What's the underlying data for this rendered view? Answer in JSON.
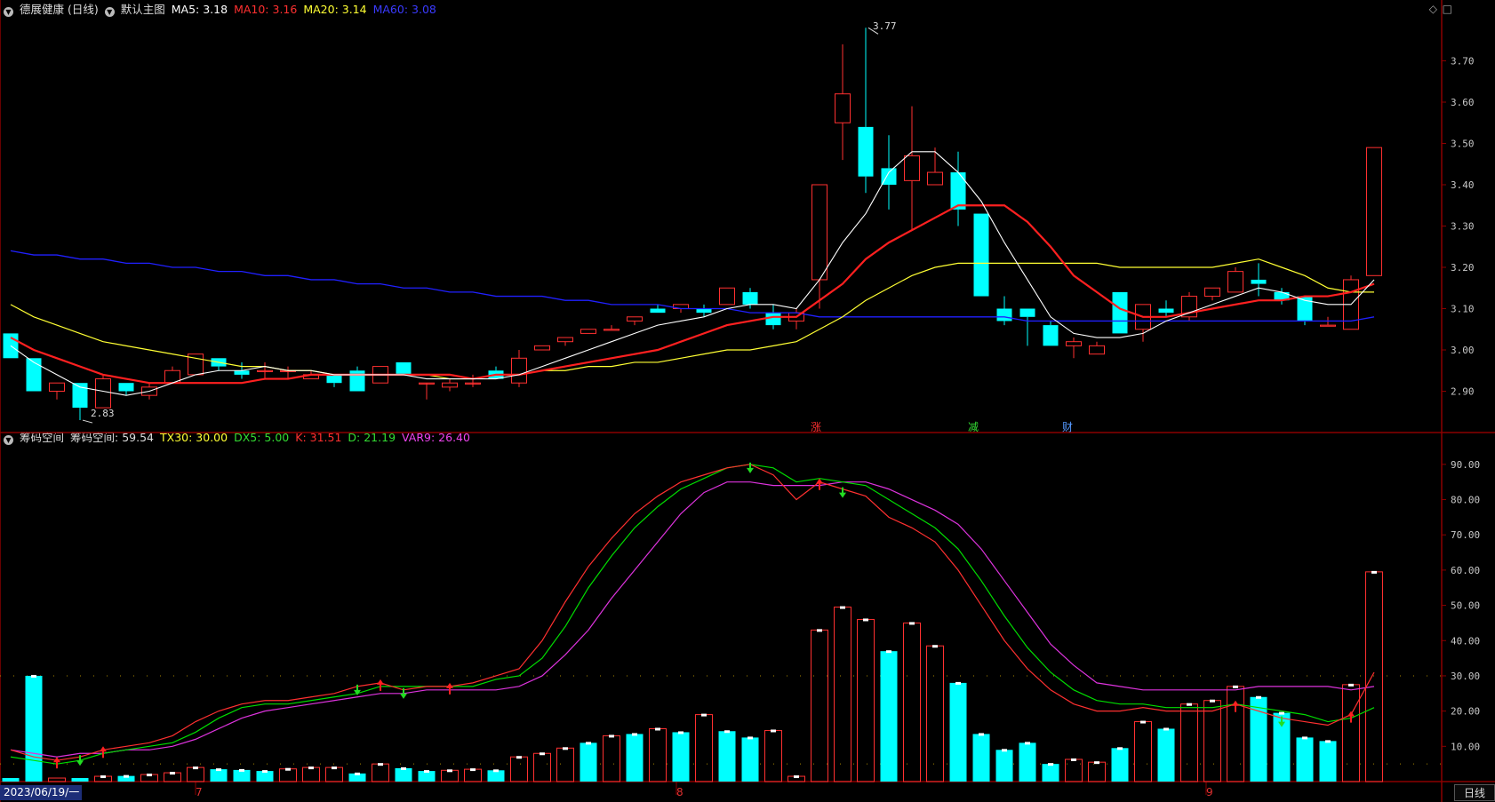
{
  "main_header": {
    "stock": "德展健康 (日线)",
    "mode": "默认主图",
    "ma5": "MA5: 3.18",
    "ma10": "MA10: 3.16",
    "ma20": "MA20: 3.14",
    "ma60": "MA60: 3.08"
  },
  "sub_header": {
    "name": "筹码空间",
    "value": "筹码空间: 59.54",
    "tx30": "TX30: 30.00",
    "dx5": "DX5: 5.00",
    "k": "K: 31.51",
    "d": "D: 21.19",
    "var9": "VAR9: 26.40"
  },
  "controls": {
    "diamond_icon": "◇",
    "square_icon": "□"
  },
  "colors": {
    "up": "#ff3030",
    "down": "#00ffff",
    "ma5": "#ffffff",
    "ma10": "#ff2020",
    "ma20": "#ffff33",
    "ma60": "#2020ff",
    "axis": "#8b0000",
    "k": "#ff3030",
    "d": "#00dd00",
    "var9": "#dd33dd"
  },
  "annotations": {
    "high": "3.77",
    "low": "2.83"
  },
  "events": [
    "涨",
    "减",
    "财"
  ],
  "footer": {
    "date": "2023/06/19/一",
    "period": "日线",
    "months": [
      "7",
      "8",
      "9"
    ]
  },
  "chart_data": [
    {
      "type": "candlestick",
      "y_axis_ticks": [
        "3.70",
        "3.60",
        "3.50",
        "3.40",
        "3.30",
        "3.20",
        "3.10",
        "3.00",
        "2.90"
      ],
      "ylim": [
        2.8,
        3.8
      ],
      "candles": [
        [
          3.04,
          2.98,
          3.04,
          2.98
        ],
        [
          2.98,
          2.9,
          2.98,
          2.9
        ],
        [
          2.9,
          2.92,
          2.92,
          2.88
        ],
        [
          2.92,
          2.86,
          2.92,
          2.83
        ],
        [
          2.86,
          2.93,
          2.94,
          2.86
        ],
        [
          2.92,
          2.9,
          2.92,
          2.89
        ],
        [
          2.89,
          2.91,
          2.92,
          2.88
        ],
        [
          2.92,
          2.95,
          2.96,
          2.92
        ],
        [
          2.94,
          2.99,
          2.99,
          2.94
        ],
        [
          2.98,
          2.96,
          2.98,
          2.95
        ],
        [
          2.95,
          2.94,
          2.97,
          2.93
        ],
        [
          2.95,
          2.95,
          2.97,
          2.93
        ],
        [
          2.95,
          2.95,
          2.96,
          2.93
        ],
        [
          2.93,
          2.94,
          2.95,
          2.93
        ],
        [
          2.94,
          2.92,
          2.94,
          2.91
        ],
        [
          2.95,
          2.9,
          2.96,
          2.9
        ],
        [
          2.92,
          2.96,
          2.96,
          2.92
        ],
        [
          2.97,
          2.94,
          2.97,
          2.94
        ],
        [
          2.92,
          2.92,
          2.92,
          2.88
        ],
        [
          2.91,
          2.92,
          2.93,
          2.9
        ],
        [
          2.92,
          2.92,
          2.94,
          2.91
        ],
        [
          2.95,
          2.93,
          2.96,
          2.93
        ],
        [
          2.92,
          2.98,
          3.0,
          2.91
        ],
        [
          3.0,
          3.01,
          3.01,
          3.0
        ],
        [
          3.02,
          3.03,
          3.03,
          3.01
        ],
        [
          3.04,
          3.05,
          3.05,
          3.04
        ],
        [
          3.05,
          3.05,
          3.06,
          3.05
        ],
        [
          3.07,
          3.08,
          3.08,
          3.06
        ],
        [
          3.1,
          3.09,
          3.11,
          3.09
        ],
        [
          3.1,
          3.11,
          3.11,
          3.09
        ],
        [
          3.1,
          3.09,
          3.11,
          3.08
        ],
        [
          3.11,
          3.15,
          3.15,
          3.11
        ],
        [
          3.14,
          3.11,
          3.15,
          3.1
        ],
        [
          3.09,
          3.06,
          3.11,
          3.05
        ],
        [
          3.07,
          3.09,
          3.1,
          3.05
        ],
        [
          3.17,
          3.4,
          3.4,
          3.1
        ],
        [
          3.55,
          3.62,
          3.74,
          3.46
        ],
        [
          3.54,
          3.42,
          3.78,
          3.38
        ],
        [
          3.44,
          3.4,
          3.52,
          3.34
        ],
        [
          3.41,
          3.47,
          3.59,
          3.29
        ],
        [
          3.4,
          3.43,
          3.49,
          3.4
        ],
        [
          3.43,
          3.34,
          3.48,
          3.3
        ],
        [
          3.33,
          3.13,
          3.33,
          3.13
        ],
        [
          3.1,
          3.07,
          3.13,
          3.06
        ],
        [
          3.1,
          3.08,
          3.1,
          3.01
        ],
        [
          3.06,
          3.01,
          3.07,
          3.01
        ],
        [
          3.01,
          3.02,
          3.03,
          2.98
        ],
        [
          2.99,
          3.01,
          3.02,
          2.99
        ],
        [
          3.14,
          3.04,
          3.14,
          3.04
        ],
        [
          3.05,
          3.11,
          3.11,
          3.02
        ],
        [
          3.1,
          3.09,
          3.12,
          3.08
        ],
        [
          3.08,
          3.13,
          3.14,
          3.07
        ],
        [
          3.13,
          3.15,
          3.15,
          3.12
        ],
        [
          3.14,
          3.19,
          3.2,
          3.14
        ],
        [
          3.17,
          3.16,
          3.21,
          3.13
        ],
        [
          3.14,
          3.12,
          3.15,
          3.11
        ],
        [
          3.13,
          3.07,
          3.13,
          3.06
        ],
        [
          3.06,
          3.06,
          3.08,
          3.06
        ],
        [
          3.05,
          3.17,
          3.18,
          3.05
        ],
        [
          3.18,
          3.49,
          3.49,
          3.18
        ]
      ],
      "ma5": [
        3.01,
        2.97,
        2.94,
        2.91,
        2.9,
        2.89,
        2.9,
        2.92,
        2.94,
        2.95,
        2.95,
        2.96,
        2.95,
        2.95,
        2.94,
        2.94,
        2.94,
        2.94,
        2.93,
        2.93,
        2.93,
        2.93,
        2.94,
        2.96,
        2.98,
        3.0,
        3.02,
        3.04,
        3.06,
        3.07,
        3.08,
        3.1,
        3.11,
        3.11,
        3.1,
        3.17,
        3.26,
        3.33,
        3.43,
        3.48,
        3.48,
        3.43,
        3.36,
        3.26,
        3.17,
        3.08,
        3.04,
        3.03,
        3.03,
        3.04,
        3.07,
        3.09,
        3.11,
        3.13,
        3.15,
        3.14,
        3.12,
        3.11,
        3.11,
        3.17
      ],
      "ma10": [
        3.03,
        3.0,
        2.98,
        2.96,
        2.94,
        2.93,
        2.92,
        2.92,
        2.92,
        2.92,
        2.92,
        2.93,
        2.93,
        2.94,
        2.94,
        2.94,
        2.94,
        2.94,
        2.94,
        2.94,
        2.93,
        2.94,
        2.94,
        2.95,
        2.96,
        2.97,
        2.98,
        2.99,
        3.0,
        3.02,
        3.04,
        3.06,
        3.07,
        3.08,
        3.08,
        3.12,
        3.16,
        3.22,
        3.26,
        3.29,
        3.32,
        3.35,
        3.35,
        3.35,
        3.31,
        3.25,
        3.18,
        3.14,
        3.1,
        3.08,
        3.08,
        3.09,
        3.1,
        3.11,
        3.12,
        3.12,
        3.13,
        3.13,
        3.14,
        3.16
      ],
      "ma20": [
        3.11,
        3.08,
        3.06,
        3.04,
        3.02,
        3.01,
        3.0,
        2.99,
        2.98,
        2.97,
        2.96,
        2.96,
        2.95,
        2.95,
        2.94,
        2.94,
        2.94,
        2.94,
        2.94,
        2.93,
        2.93,
        2.94,
        2.94,
        2.95,
        2.95,
        2.96,
        2.96,
        2.97,
        2.97,
        2.98,
        2.99,
        3.0,
        3.0,
        3.01,
        3.02,
        3.05,
        3.08,
        3.12,
        3.15,
        3.18,
        3.2,
        3.21,
        3.21,
        3.21,
        3.21,
        3.21,
        3.21,
        3.21,
        3.2,
        3.2,
        3.2,
        3.2,
        3.2,
        3.21,
        3.22,
        3.2,
        3.18,
        3.15,
        3.14,
        3.14
      ],
      "ma60": [
        3.24,
        3.23,
        3.23,
        3.22,
        3.22,
        3.21,
        3.21,
        3.2,
        3.2,
        3.19,
        3.19,
        3.18,
        3.18,
        3.17,
        3.17,
        3.16,
        3.16,
        3.15,
        3.15,
        3.14,
        3.14,
        3.13,
        3.13,
        3.13,
        3.12,
        3.12,
        3.11,
        3.11,
        3.11,
        3.1,
        3.1,
        3.1,
        3.09,
        3.09,
        3.09,
        3.08,
        3.08,
        3.08,
        3.08,
        3.08,
        3.08,
        3.08,
        3.08,
        3.08,
        3.07,
        3.07,
        3.07,
        3.07,
        3.07,
        3.07,
        3.07,
        3.07,
        3.07,
        3.07,
        3.07,
        3.07,
        3.07,
        3.07,
        3.07,
        3.08
      ]
    },
    {
      "type": "bar+line",
      "y_axis_ticks": [
        "90.00",
        "80.00",
        "70.00",
        "60.00",
        "50.00",
        "40.00",
        "30.00",
        "20.00",
        "10.00"
      ],
      "ylim": [
        0,
        95
      ],
      "bars": [
        [
          1,
          "d"
        ],
        [
          30,
          "d"
        ],
        [
          1,
          "u"
        ],
        [
          1,
          "d"
        ],
        [
          1.5,
          "u"
        ],
        [
          1.6,
          "d"
        ],
        [
          2,
          "u"
        ],
        [
          2.5,
          "u"
        ],
        [
          4,
          "u"
        ],
        [
          3.5,
          "d"
        ],
        [
          3.3,
          "d"
        ],
        [
          3,
          "d"
        ],
        [
          3.6,
          "u"
        ],
        [
          4,
          "u"
        ],
        [
          4,
          "u"
        ],
        [
          2.3,
          "d"
        ],
        [
          5,
          "u"
        ],
        [
          3.8,
          "d"
        ],
        [
          3,
          "d"
        ],
        [
          3.2,
          "u"
        ],
        [
          3.5,
          "u"
        ],
        [
          3.2,
          "d"
        ],
        [
          7,
          "u"
        ],
        [
          8,
          "u"
        ],
        [
          9.5,
          "u"
        ],
        [
          11,
          "d"
        ],
        [
          13,
          "u"
        ],
        [
          13.5,
          "d"
        ],
        [
          15,
          "u"
        ],
        [
          14,
          "d"
        ],
        [
          19,
          "u"
        ],
        [
          14.3,
          "d"
        ],
        [
          12.5,
          "d"
        ],
        [
          14.5,
          "u"
        ],
        [
          1.5,
          "u"
        ],
        [
          43,
          "u"
        ],
        [
          49.5,
          "u"
        ],
        [
          46,
          "u"
        ],
        [
          37,
          "d"
        ],
        [
          45,
          "u"
        ],
        [
          38.5,
          "u"
        ],
        [
          28,
          "d"
        ],
        [
          13.5,
          "d"
        ],
        [
          9,
          "d"
        ],
        [
          11,
          "d"
        ],
        [
          5,
          "d"
        ],
        [
          6.3,
          "u"
        ],
        [
          5.5,
          "u"
        ],
        [
          9.5,
          "d"
        ],
        [
          17,
          "u"
        ],
        [
          15,
          "d"
        ],
        [
          22,
          "u"
        ],
        [
          23,
          "u"
        ],
        [
          27,
          "u"
        ],
        [
          24,
          "d"
        ],
        [
          19.5,
          "d"
        ],
        [
          12.5,
          "d"
        ],
        [
          11.5,
          "d"
        ],
        [
          27.5,
          "u"
        ],
        [
          59.5,
          "u"
        ]
      ],
      "k": [
        9,
        7,
        6,
        7,
        9,
        10,
        11,
        13,
        17,
        20,
        22,
        23,
        23,
        24,
        25,
        27,
        28,
        26,
        27,
        27,
        28,
        30,
        32,
        40,
        51,
        61,
        69,
        76,
        81,
        85,
        87,
        89,
        90,
        87,
        80,
        85,
        83,
        81,
        75,
        72,
        68,
        60,
        50,
        40,
        32,
        26,
        22,
        20,
        20,
        21,
        20,
        20,
        20,
        22,
        20,
        18,
        17,
        16,
        19,
        31
      ],
      "d": [
        7,
        6,
        5,
        6,
        8,
        9,
        10,
        11,
        14,
        18,
        21,
        22,
        22,
        23,
        24,
        25,
        27,
        27,
        27,
        27,
        27,
        29,
        30,
        35,
        44,
        55,
        64,
        72,
        78,
        83,
        86,
        89,
        90,
        89,
        85,
        86,
        85,
        84,
        80,
        76,
        72,
        66,
        57,
        47,
        38,
        31,
        26,
        23,
        22,
        22,
        21,
        21,
        21,
        22,
        21,
        20,
        19,
        17,
        18,
        21
      ],
      "var9": [
        9,
        8,
        7,
        8,
        8,
        9,
        9,
        10,
        12,
        15,
        18,
        20,
        21,
        22,
        23,
        24,
        25,
        25,
        26,
        26,
        26,
        26,
        27,
        30,
        36,
        43,
        52,
        60,
        68,
        76,
        82,
        85,
        85,
        84,
        84,
        84,
        85,
        85,
        83,
        80,
        77,
        73,
        66,
        57,
        48,
        39,
        33,
        28,
        27,
        26,
        26,
        26,
        26,
        26,
        27,
        27,
        27,
        27,
        26,
        27
      ]
    }
  ]
}
